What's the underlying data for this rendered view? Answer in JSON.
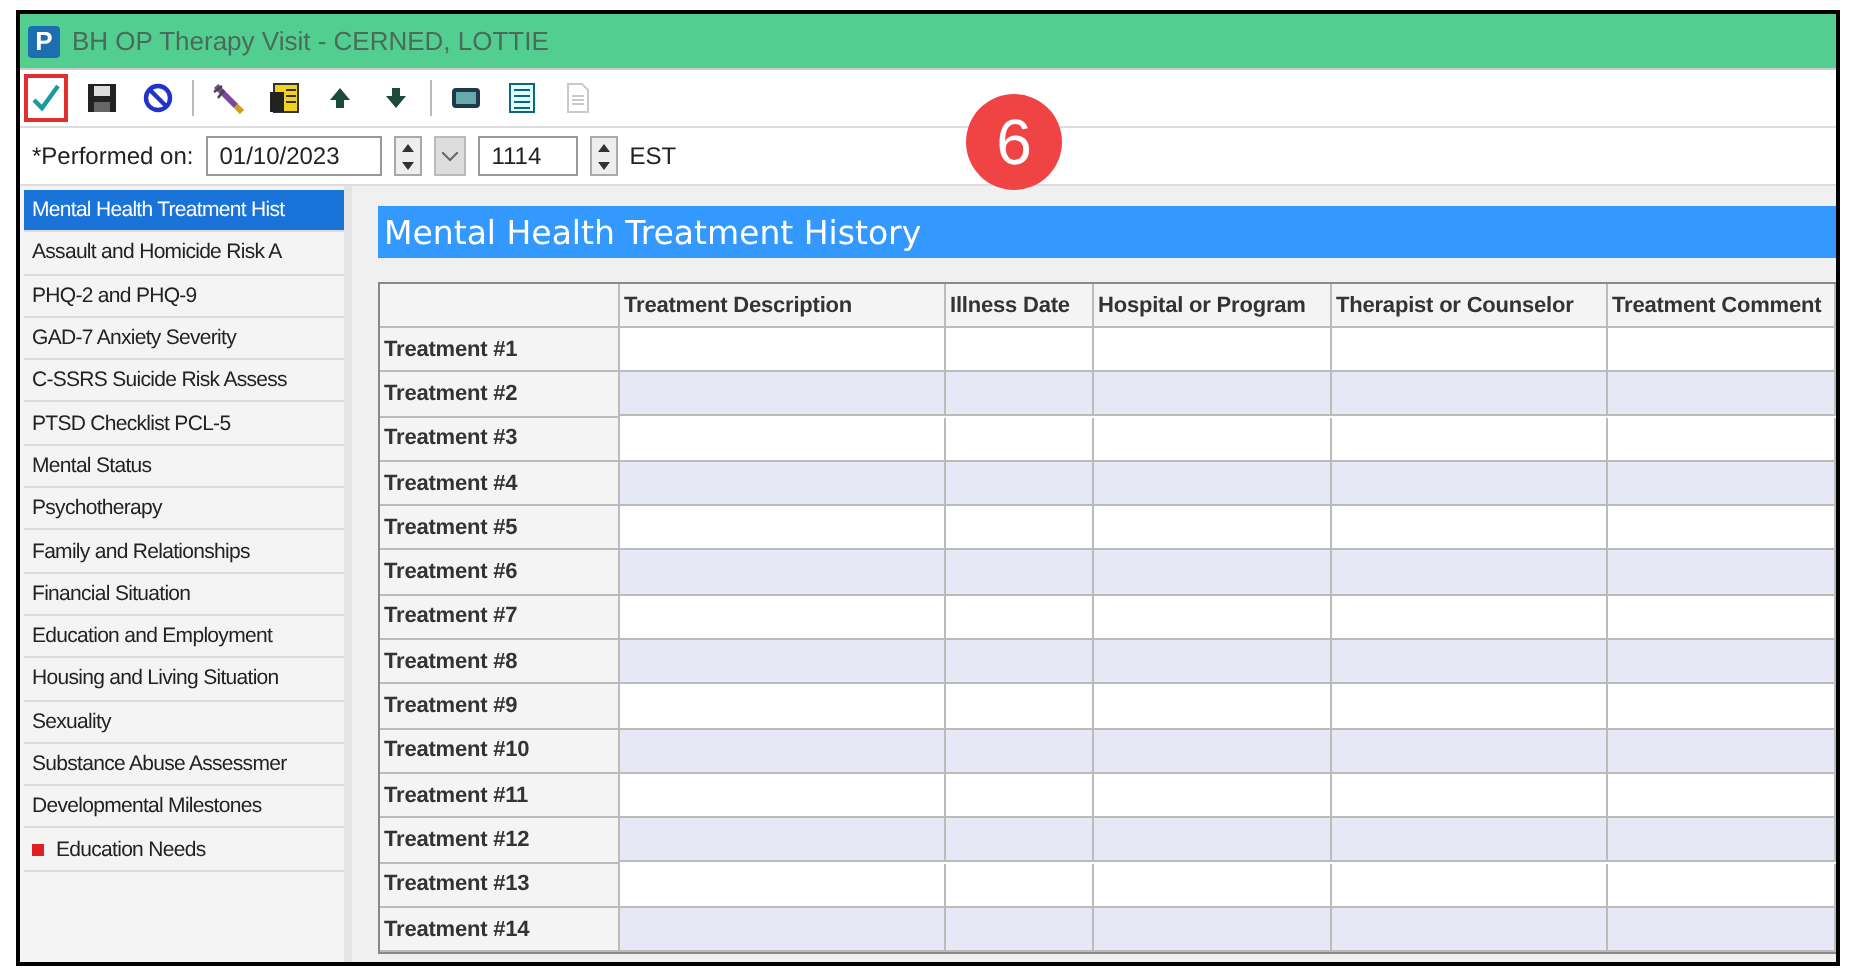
{
  "window": {
    "title": "BH OP Therapy Visit - CERNED, LOTTIE",
    "app_letter": "P"
  },
  "toolbar": [
    [
      {
        "kind": "check",
        "highlighted": true,
        "disabled": false
      },
      {
        "kind": "save",
        "highlighted": false,
        "disabled": false
      },
      {
        "kind": "cancel",
        "highlighted": false,
        "disabled": false
      }
    ],
    [
      {
        "kind": "pen",
        "highlighted": false,
        "disabled": false
      },
      {
        "kind": "notes",
        "highlighted": false,
        "disabled": false
      },
      {
        "kind": "up",
        "highlighted": false,
        "disabled": false
      },
      {
        "kind": "down",
        "highlighted": false,
        "disabled": false
      }
    ],
    [
      {
        "kind": "monitor",
        "highlighted": false,
        "disabled": false
      },
      {
        "kind": "list",
        "highlighted": false,
        "disabled": false
      },
      {
        "kind": "document",
        "highlighted": false,
        "disabled": true
      }
    ]
  ],
  "annotation": {
    "label": "6"
  },
  "performed": {
    "label": "*Performed on:",
    "date": "01/10/2023",
    "time": "1114",
    "timezone": "EST"
  },
  "sidebar": {
    "items": [
      {
        "label": "Mental Health Treatment Hist",
        "selected": true,
        "required": false
      },
      {
        "label": "Assault and Homicide Risk A",
        "selected": false,
        "required": false
      },
      {
        "label": "PHQ-2 and PHQ-9",
        "selected": false,
        "required": false
      },
      {
        "label": "GAD-7 Anxiety Severity",
        "selected": false,
        "required": false
      },
      {
        "label": "C-SSRS Suicide Risk Assess",
        "selected": false,
        "required": false
      },
      {
        "label": "PTSD Checklist PCL-5",
        "selected": false,
        "required": false
      },
      {
        "label": "Mental Status",
        "selected": false,
        "required": false
      },
      {
        "label": "Psychotherapy",
        "selected": false,
        "required": false
      },
      {
        "label": "Family and Relationships",
        "selected": false,
        "required": false
      },
      {
        "label": "Financial Situation",
        "selected": false,
        "required": false
      },
      {
        "label": "Education and Employment",
        "selected": false,
        "required": false
      },
      {
        "label": "Housing and Living Situation",
        "selected": false,
        "required": false
      },
      {
        "label": "Sexuality",
        "selected": false,
        "required": false
      },
      {
        "label": "Substance Abuse Assessmer",
        "selected": false,
        "required": false
      },
      {
        "label": "Developmental Milestones",
        "selected": false,
        "required": false
      },
      {
        "label": "Education Needs",
        "selected": false,
        "required": true
      }
    ]
  },
  "section": {
    "title": "Mental Health Treatment History"
  },
  "table": {
    "columns": [
      "Treatment Description",
      "Illness Date",
      "Hospital or Program",
      "Therapist or Counselor",
      "Treatment Comment"
    ],
    "rows": [
      "Treatment #1",
      "Treatment #2",
      "Treatment #3",
      "Treatment #4",
      "Treatment #5",
      "Treatment #6",
      "Treatment #7",
      "Treatment #8",
      "Treatment #9",
      "Treatment #10",
      "Treatment #11",
      "Treatment #12",
      "Treatment #13",
      "Treatment #14"
    ]
  }
}
